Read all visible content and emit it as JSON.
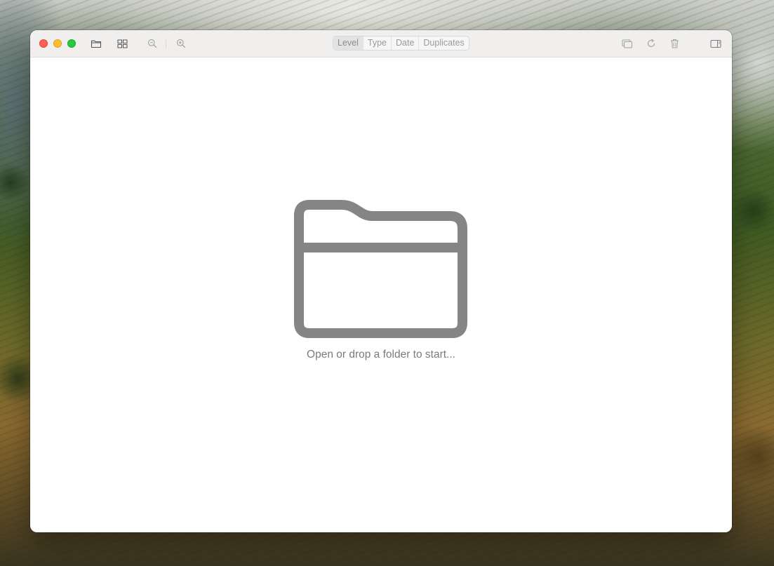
{
  "window": {
    "traffic_lights": [
      "close",
      "minimize",
      "zoom"
    ]
  },
  "toolbar": {
    "left_icons": [
      "folder-icon",
      "grid-icon",
      "zoom-out-icon",
      "zoom-in-icon"
    ],
    "sort_tabs": [
      {
        "label": "Level",
        "selected": true
      },
      {
        "label": "Type",
        "selected": false
      },
      {
        "label": "Date",
        "selected": false
      },
      {
        "label": "Duplicates",
        "selected": false
      }
    ],
    "right_icons": [
      "copy-icon",
      "refresh-icon",
      "trash-icon",
      "sidebar-icon"
    ]
  },
  "empty_state": {
    "icon": "folder-icon",
    "message": "Open or drop a folder to start..."
  },
  "colors": {
    "icon_gray": "#8a8a8a",
    "big_folder": "#858585",
    "close": "#fe5f57",
    "minimize": "#febc2e",
    "zoom": "#28c840"
  }
}
